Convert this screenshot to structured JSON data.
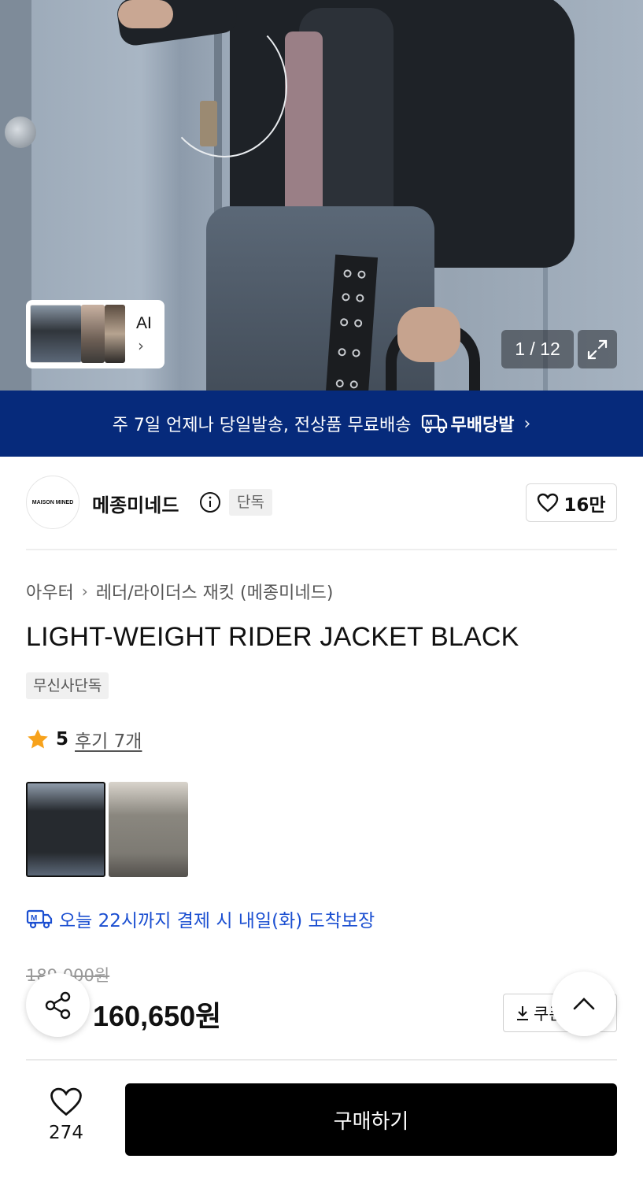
{
  "gallery": {
    "counter": "1 / 12",
    "ai_label": "AI"
  },
  "banner": {
    "text": "주 7일 언제나 당일발송, 전상품 무료배송",
    "badge_label": "무배당발"
  },
  "brand": {
    "logo_text": "MAISON MINED",
    "name": "메종미네드",
    "tag": "단독",
    "likes": "16만"
  },
  "breadcrumb": [
    "아우터",
    "레더/라이더스 재킷 (메종미네드)"
  ],
  "product": {
    "title": "LIGHT-WEIGHT RIDER JACKET BLACK",
    "exclusive_tag": "무신사단독",
    "rating": "5",
    "reviews": "후기 7개",
    "delivery": "오늘 22시까지 결제 시 내일(화) 도착보장",
    "original_price": "189,000원",
    "price": "160,650원",
    "coupon_label": "쿠폰"
  },
  "bottom_bar": {
    "wish_count": "274",
    "buy_label": "구매하기"
  },
  "colors": {
    "banner_bg": "#062a7b",
    "delivery_blue": "#1b4fd1",
    "star": "#f7a21b",
    "buy_bg": "#000000"
  },
  "icons": [
    "heart-icon",
    "info-icon",
    "star-icon",
    "share-icon",
    "chevron-up-icon",
    "expand-icon",
    "truck-icon",
    "download-icon",
    "chevron-right-icon"
  ]
}
